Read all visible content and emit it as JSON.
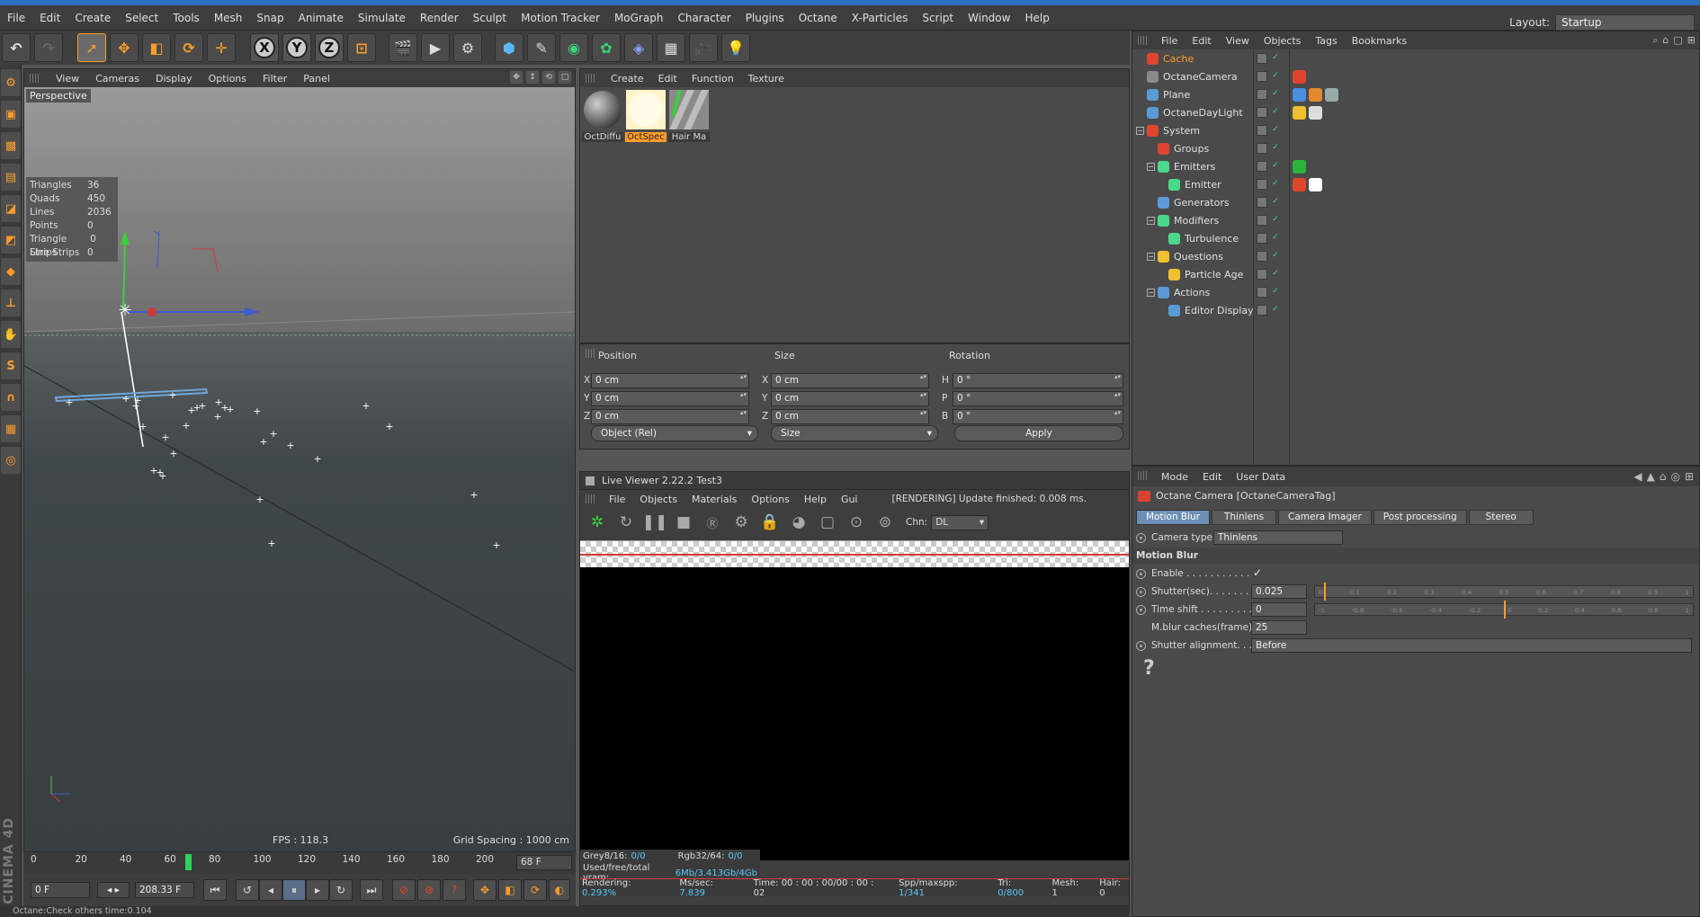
{
  "menu": [
    "File",
    "Edit",
    "Create",
    "Select",
    "Tools",
    "Mesh",
    "Snap",
    "Animate",
    "Simulate",
    "Render",
    "Sculpt",
    "Motion Tracker",
    "MoGraph",
    "Character",
    "Plugins",
    "Octane",
    "X-Particles",
    "Script",
    "Window",
    "Help"
  ],
  "layout": {
    "label": "Layout:",
    "value": "Startup"
  },
  "viewport": {
    "menu": [
      "View",
      "Cameras",
      "Display",
      "Options",
      "Filter",
      "Panel"
    ],
    "label": "Perspective",
    "stats": [
      {
        "k": "Triangles",
        "v": "36"
      },
      {
        "k": "Quads",
        "v": "450"
      },
      {
        "k": "Lines",
        "v": "2036"
      },
      {
        "k": "Points",
        "v": "0"
      },
      {
        "k": "Triangle Strips",
        "v": "0"
      },
      {
        "k": "Line Strips",
        "v": "0"
      }
    ],
    "fps": "FPS : 118.3",
    "grid_spacing": "Grid Spacing : 1000 cm"
  },
  "timeline": {
    "ticks": [
      "0",
      "20",
      "40",
      "60",
      "80",
      "100",
      "120",
      "140",
      "160",
      "180",
      "200"
    ],
    "frame_end": "68 F",
    "current_frame": "0 F",
    "fps_field": "208.33 F"
  },
  "status": "Octane:Check others time:0.104",
  "brand": "CINEMA 4D",
  "materials": {
    "menu": [
      "Create",
      "Edit",
      "Function",
      "Texture"
    ],
    "items": [
      "OctDiffu",
      "OctSpec",
      "Hair Ma"
    ]
  },
  "coords": {
    "headers": [
      "Position",
      "Size",
      "Rotation"
    ],
    "position": [
      {
        "axis": "X",
        "value": "0 cm"
      },
      {
        "axis": "Y",
        "value": "0 cm"
      },
      {
        "axis": "Z",
        "value": "0 cm"
      }
    ],
    "size": [
      {
        "axis": "X",
        "value": "0 cm"
      },
      {
        "axis": "Y",
        "value": "0 cm"
      },
      {
        "axis": "Z",
        "value": "0 cm"
      }
    ],
    "rotation": [
      {
        "axis": "H",
        "value": "0 °"
      },
      {
        "axis": "P",
        "value": "0 °"
      },
      {
        "axis": "B",
        "value": "0 °"
      }
    ],
    "mode": "Object (Rel)",
    "size_mode": "Size",
    "apply": "Apply"
  },
  "live_viewer": {
    "title": "Live Viewer 2.22.2 Test3",
    "menu": [
      "File",
      "Objects",
      "Materials",
      "Options",
      "Help",
      "Gui"
    ],
    "status": "[RENDERING] Update finished: 0.008 ms.",
    "chn_label": "Chn:",
    "chn_value": "DL",
    "info": {
      "grey_label": "Grey8/16:",
      "grey_val": "0/0",
      "rgb_label": "Rgb32/64:",
      "rgb_val": "0/0",
      "vram_label": "Used/free/total vram:",
      "vram_val": "6Mb/3.413Gb/4Gb"
    },
    "bottom": {
      "rendering_label": "Rendering:",
      "rendering_val": "0.293%",
      "ms_label": "Ms/sec:",
      "ms_val": "7.839",
      "time_label": "Time:",
      "time_val": "00 : 00 : 00/00 : 00 : 02",
      "spp_label": "Spp/maxspp:",
      "spp_val": "1/341",
      "tri_label": "Tri:",
      "tri_val": "0/800",
      "mesh_label": "Mesh:",
      "mesh_val": "1",
      "hair_label": "Hair:",
      "hair_val": "0"
    }
  },
  "objects": {
    "menu": [
      "File",
      "Edit",
      "View",
      "Objects",
      "Tags",
      "Bookmarks"
    ],
    "items": [
      {
        "name": "Cache",
        "indent": 0,
        "color": "#e0452d",
        "selected": true,
        "tags": []
      },
      {
        "name": "OctaneCamera",
        "indent": 0,
        "color": "#8a8a8a",
        "selected": false,
        "tags": [
          "#e0452d"
        ]
      },
      {
        "name": "Plane",
        "indent": 0,
        "color": "#5b9bd5",
        "selected": false,
        "tags": [
          "#4a8fe0",
          "#e08a2d",
          "#9aa"
        ]
      },
      {
        "name": "OctaneDayLight",
        "indent": 0,
        "color": "#5b9bd5",
        "selected": false,
        "tags": [
          "#f0c030",
          "#ddd"
        ]
      },
      {
        "name": "System",
        "indent": 0,
        "color": "#e0452d",
        "selected": false,
        "tags": []
      },
      {
        "name": "Groups",
        "indent": 1,
        "color": "#e0452d",
        "selected": false,
        "tags": []
      },
      {
        "name": "Emitters",
        "indent": 1,
        "color": "#4ad98a",
        "selected": false,
        "tags": [
          "#2cb33a"
        ]
      },
      {
        "name": "Emitter",
        "indent": 2,
        "color": "#4ad98a",
        "selected": false,
        "tags": [
          "#e0452d",
          "#ffffff"
        ]
      },
      {
        "name": "Generators",
        "indent": 1,
        "color": "#5b9bd5",
        "selected": false,
        "tags": []
      },
      {
        "name": "Modifiers",
        "indent": 1,
        "color": "#4ad98a",
        "selected": false,
        "tags": []
      },
      {
        "name": "Turbulence",
        "indent": 2,
        "color": "#4ad98a",
        "selected": false,
        "tags": []
      },
      {
        "name": "Questions",
        "indent": 1,
        "color": "#f0c030",
        "selected": false,
        "tags": []
      },
      {
        "name": "Particle Age",
        "indent": 2,
        "color": "#f0c030",
        "selected": false,
        "tags": []
      },
      {
        "name": "Actions",
        "indent": 1,
        "color": "#5b9bd5",
        "selected": false,
        "tags": []
      },
      {
        "name": "Editor Display",
        "indent": 2,
        "color": "#5b9bd5",
        "selected": false,
        "tags": []
      }
    ]
  },
  "attributes": {
    "menu": [
      "Mode",
      "Edit",
      "User Data"
    ],
    "title": "Octane Camera [OctaneCameraTag]",
    "tabs": [
      "Motion Blur",
      "Thinlens",
      "Camera Imager",
      "Post processing",
      "Stereo"
    ],
    "camera_type_label": "Camera type",
    "camera_type_value": "Thinlens",
    "section": "Motion Blur",
    "enable_label": "Enable . . . . . . . . . . .",
    "enable_value": "✓",
    "shutter_label": "Shutter(sec). . . . . . .",
    "shutter_value": "0.025",
    "timeshift_label": "Time shift . . . . . . . . .",
    "timeshift_value": "0",
    "caches_label": "M.blur caches(frame)",
    "caches_value": "25",
    "alignment_label": "Shutter alignment. . .",
    "alignment_value": "Before",
    "help": "?"
  }
}
